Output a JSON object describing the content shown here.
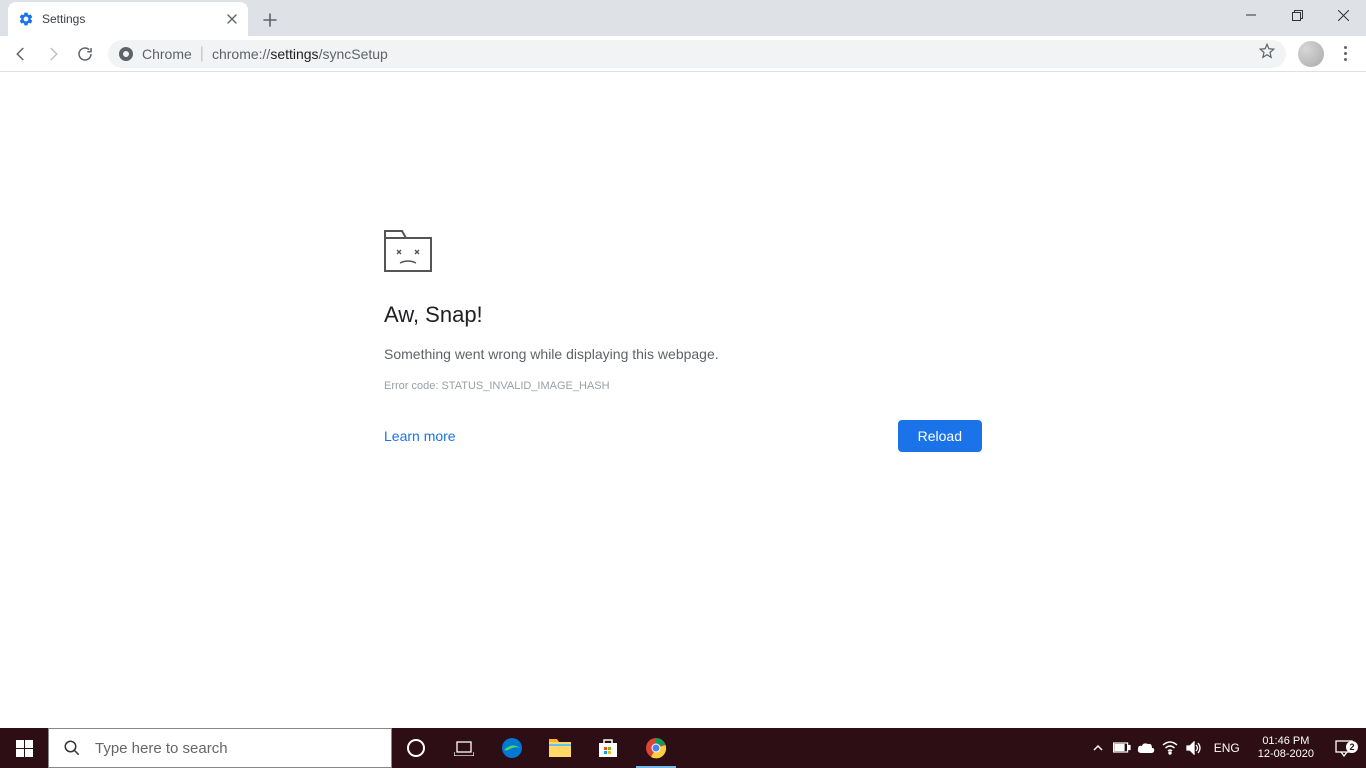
{
  "tab": {
    "title": "Settings"
  },
  "omnibox": {
    "origin": "Chrome",
    "path_prefix": "chrome://",
    "path_bold": "settings",
    "path_suffix": "/syncSetup"
  },
  "error": {
    "title": "Aw, Snap!",
    "message": "Something went wrong while displaying this webpage.",
    "code": "Error code: STATUS_INVALID_IMAGE_HASH",
    "learn_label": "Learn more",
    "reload_label": "Reload"
  },
  "taskbar": {
    "search_placeholder": "Type here to search",
    "lang": "ENG",
    "time": "01:46 PM",
    "date": "12-08-2020",
    "notif_count": "2"
  }
}
